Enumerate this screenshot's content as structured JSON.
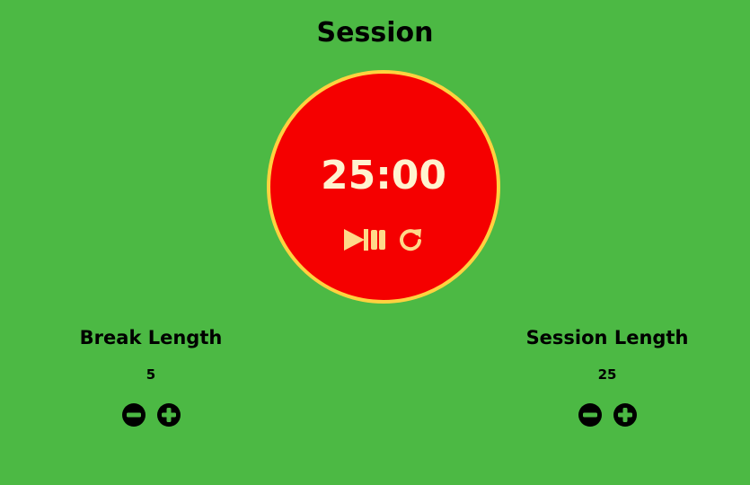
{
  "header": {
    "title": "Session"
  },
  "timer": {
    "display": "25:00",
    "controls": [
      {
        "name": "play-pause",
        "icon": "play-pause-icon"
      },
      {
        "name": "reset",
        "icon": "refresh-icon"
      }
    ]
  },
  "break_length": {
    "label": "Break Length",
    "value": "5",
    "decrement_icon": "minus-circle-icon",
    "increment_icon": "plus-circle-icon"
  },
  "session_length": {
    "label": "Session Length",
    "value": "25",
    "decrement_icon": "minus-circle-icon",
    "increment_icon": "plus-circle-icon"
  },
  "colors": {
    "background": "#4cb944",
    "clock_fill": "#f50000",
    "clock_border": "#ffd23f",
    "clock_text": "#fff3d0",
    "text": "#000000"
  }
}
